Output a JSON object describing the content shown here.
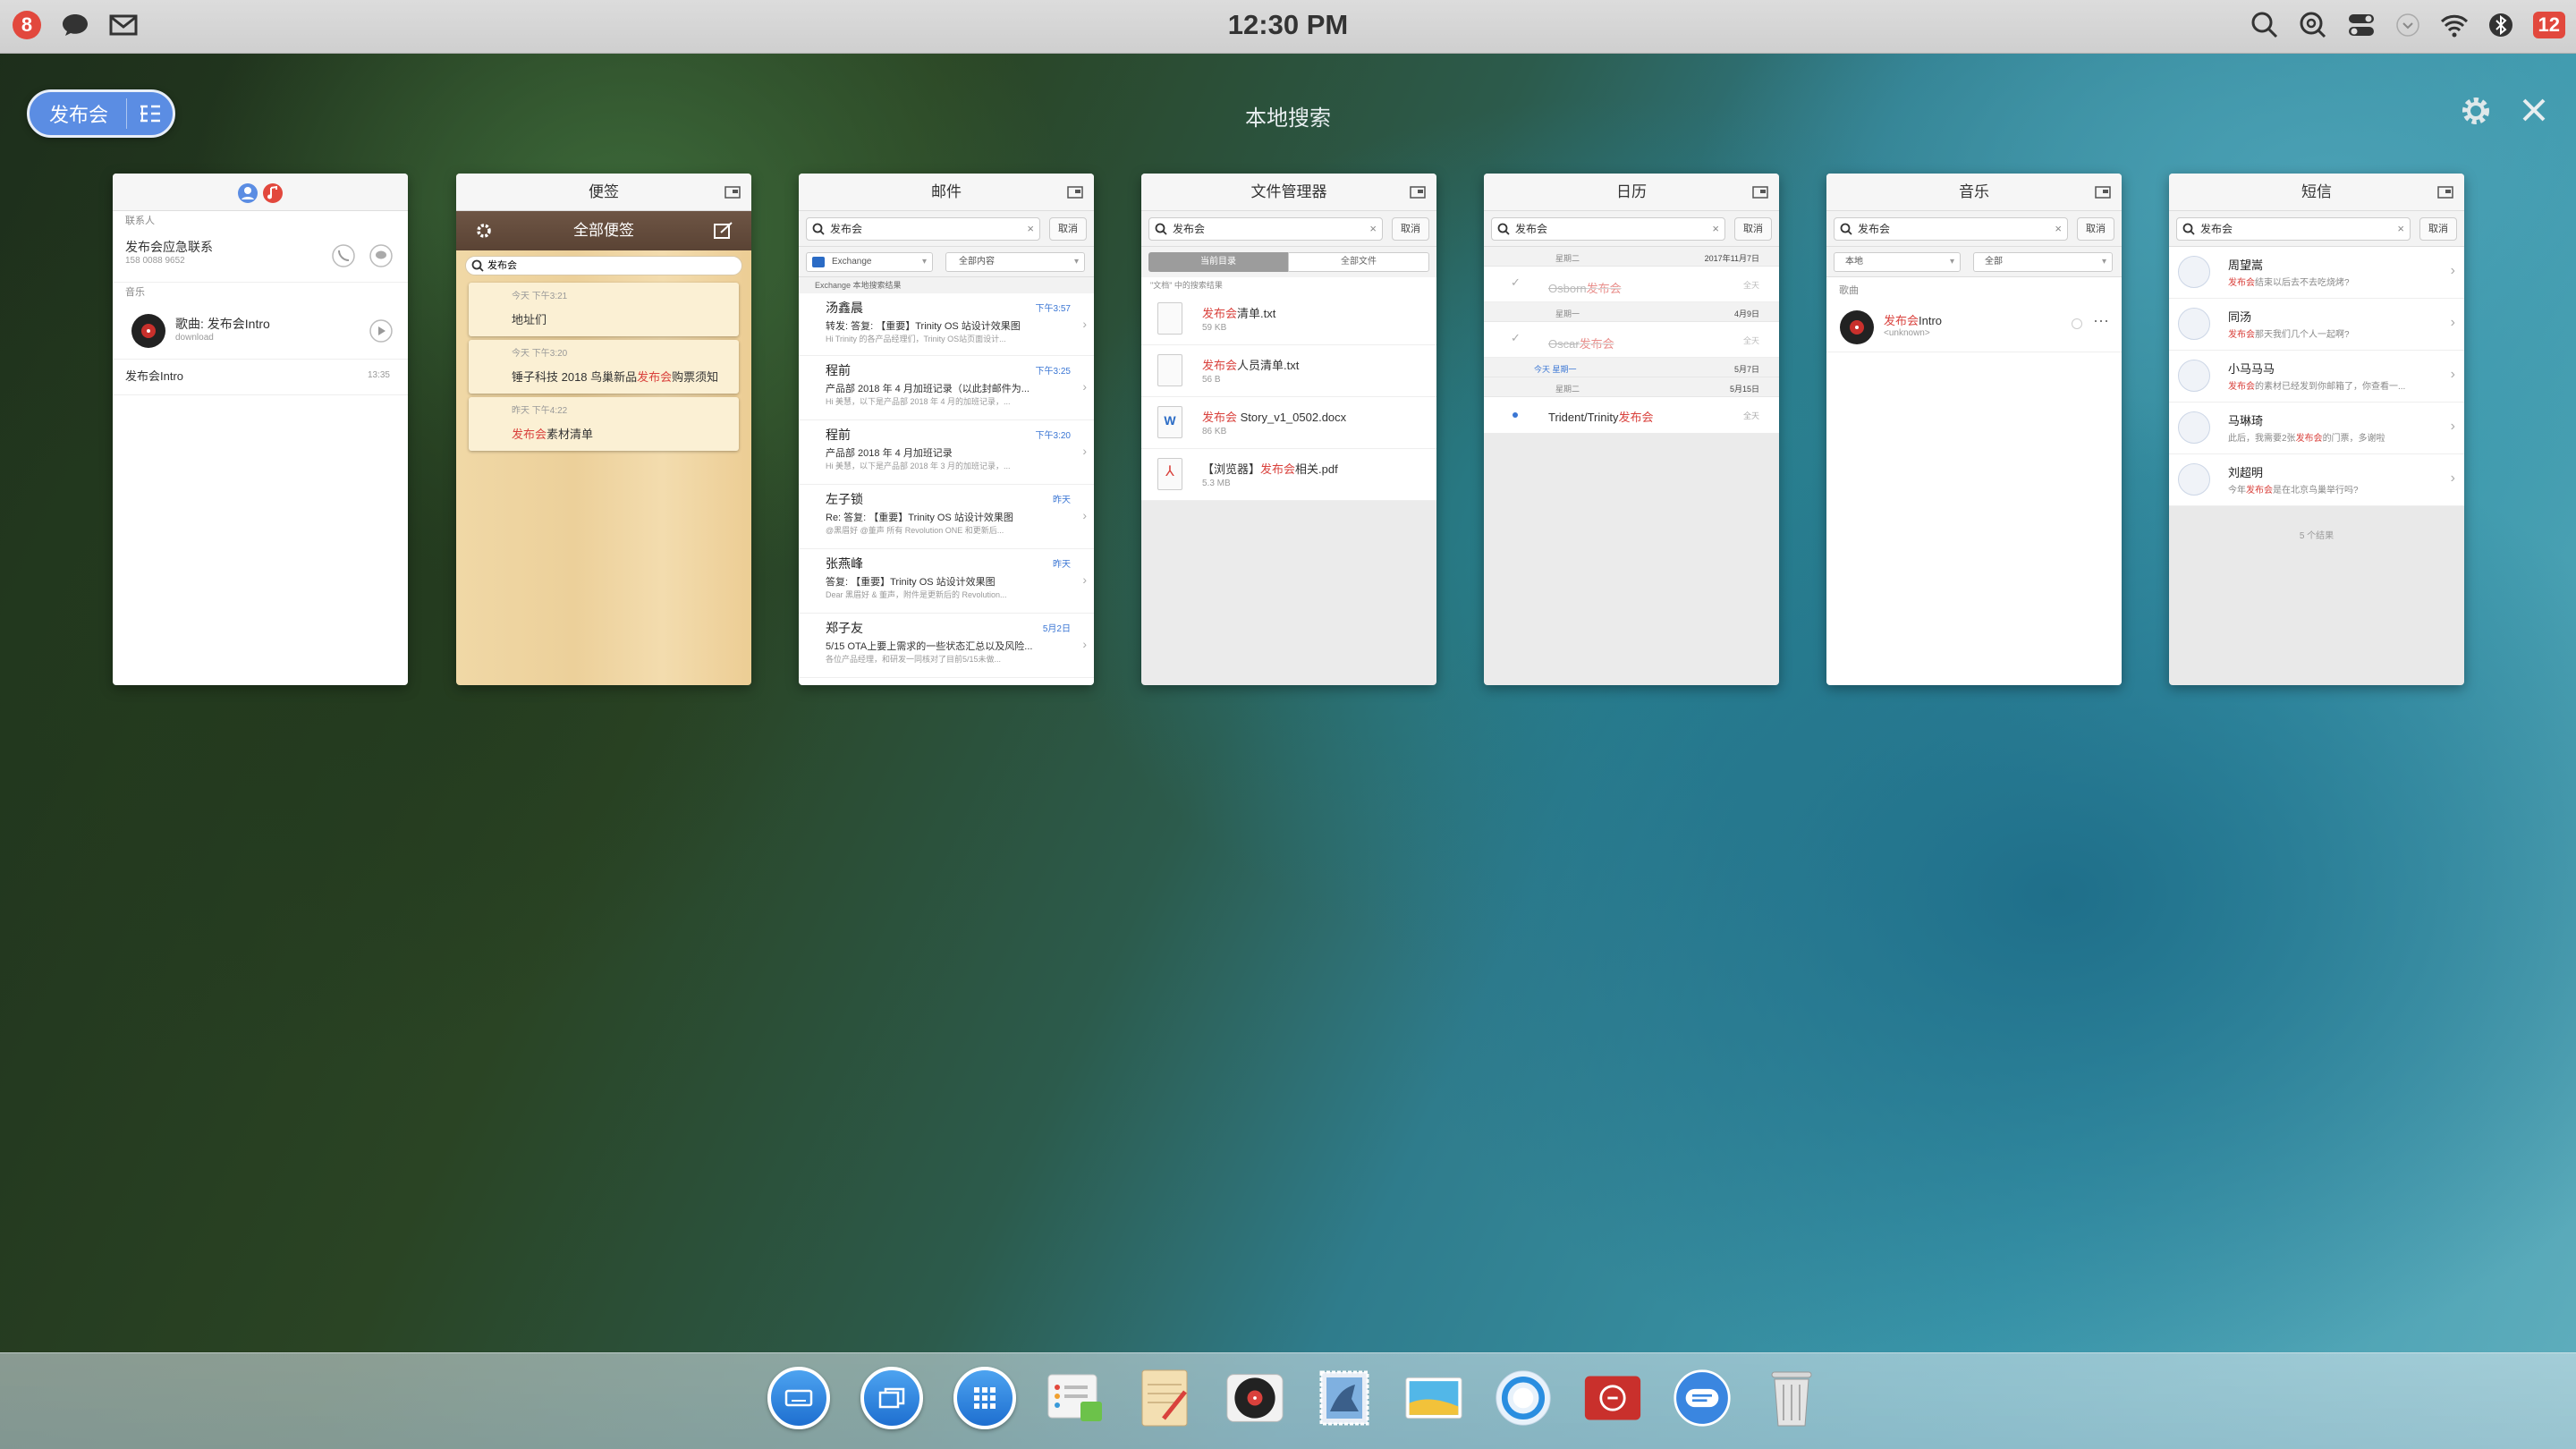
{
  "topbar": {
    "notif_count": "8",
    "time": "12:30 PM",
    "badge_count": "12"
  },
  "pill": {
    "label": "发布会"
  },
  "page_title": "本地搜索",
  "cards": {
    "contacts": {
      "section_contacts": "联系人",
      "contact_name": "发布会应急联系",
      "contact_phone": "158 0088 9652",
      "section_music": "音乐",
      "song": "歌曲: 发布会Intro",
      "song_sub": "download",
      "item": "发布会Intro",
      "item_time": "13:35"
    },
    "notes": {
      "title": "便签",
      "header": "全部便签",
      "query": "发布会",
      "notes": [
        {
          "date": "今天 下午3:21",
          "text": "地址们"
        },
        {
          "date": "今天 下午3:20",
          "text_pre": "锤子科技 2018 鸟巢新品",
          "text_hl": "发布会",
          "text_post": "购票须知"
        },
        {
          "date": "昨天 下午4:22",
          "text_hl": "发布会",
          "text_post": "素材清单"
        }
      ]
    },
    "mail": {
      "title": "邮件",
      "query": "发布会",
      "cancel": "取消",
      "account": "Exchange",
      "filter": "全部内容",
      "section": "Exchange 本地搜索结果",
      "rows": [
        {
          "name": "汤鑫晨",
          "time": "下午3:57",
          "subject": "转发: 答复: 【重要】Trinity OS 站设计效果图",
          "preview": "Hi Trinity 的各产品经理们，Trinity OS站页面设计..."
        },
        {
          "name": "程前",
          "time": "下午3:25",
          "subject": "产品部 2018 年 4 月加班记录（以此封邮件为...",
          "preview": "Hi 美慧，以下是产品部 2018 年 4 月的加班记录，..."
        },
        {
          "name": "程前",
          "time": "下午3:20",
          "subject": "产品部 2018 年 4 月加班记录",
          "preview": "Hi 美慧，以下是产品部 2018 年 3 月的加班记录，..."
        },
        {
          "name": "左子锁",
          "time": "昨天",
          "subject": "Re: 答复: 【重要】Trinity OS 站设计效果图",
          "preview": "@黑眉好 @董声 所有 Revolution ONE 和更新后..."
        },
        {
          "name": "张燕峰",
          "time": "昨天",
          "subject": "答复: 【重要】Trinity OS 站设计效果图",
          "preview": "Dear 黑眉好 & 董声，附件是更新后的 Revolution..."
        },
        {
          "name": "郑子友",
          "time": "5月2日",
          "subject": "5/15 OTA上要上需求的一些状态汇总以及风险...",
          "preview": "各位产品经理，和研发一同核对了目前5/15未做..."
        }
      ]
    },
    "files": {
      "title": "文件管理器",
      "query": "发布会",
      "cancel": "取消",
      "tab1": "当前目录",
      "tab2": "全部文件",
      "section": "\"文档\" 中的搜索结果",
      "files": [
        {
          "hl": "发布会",
          "rest": "清单.txt",
          "size": "59 KB"
        },
        {
          "hl": "发布会",
          "rest": "人员清单.txt",
          "size": "56 B"
        },
        {
          "hl": "发布会",
          "rest": " Story_v1_0502.docx",
          "size": "86 KB"
        },
        {
          "pre": "【浏览器】",
          "hl": "发布会",
          "rest": "相关.pdf",
          "size": "5.3 MB"
        }
      ]
    },
    "calendar": {
      "title": "日历",
      "query": "发布会",
      "cancel": "取消",
      "rows": [
        {
          "day": "星期二",
          "date": "2017年11月7日"
        },
        {
          "ev_pre": "Osborn",
          "ev_hl": "发布会",
          "tag": "全天"
        },
        {
          "day": "星期一",
          "date": "4月9日"
        },
        {
          "ev_pre": "Oscar",
          "ev_hl": "发布会",
          "tag": "全天"
        },
        {
          "day": "今天 星期一",
          "date": "5月7日"
        },
        {
          "day": "星期二",
          "date": "5月15日"
        },
        {
          "ev_pre": "Trident/Trinity",
          "ev_hl": "发布会",
          "tag": "全天"
        }
      ]
    },
    "music": {
      "title": "音乐",
      "query": "发布会",
      "cancel": "取消",
      "filter1": "本地",
      "filter2": "全部",
      "section": "歌曲",
      "song_hl": "发布会",
      "song_rest": "Intro",
      "artist": "<unknown>"
    },
    "sms": {
      "title": "短信",
      "query": "发布会",
      "cancel": "取消",
      "rows": [
        {
          "name": "周望嵩",
          "hl": "发布会",
          "msg": "结束以后去不去吃烧烤?"
        },
        {
          "name": "同汤",
          "hl": "发布会",
          "msg": "那天我们几个人一起啊?"
        },
        {
          "name": "小马马马",
          "hl": "发布会",
          "msg": "的素材已经发到你邮箱了，你查看一..."
        },
        {
          "name": "马琳琦",
          "pre": "此后，我需要2张",
          "hl": "发布会",
          "msg": "的门票，多谢啦"
        },
        {
          "name": "刘超明",
          "pre": "今年",
          "hl": "发布会",
          "msg": "是在北京鸟巢举行吗?"
        }
      ],
      "result_count": "5 个结果"
    }
  }
}
